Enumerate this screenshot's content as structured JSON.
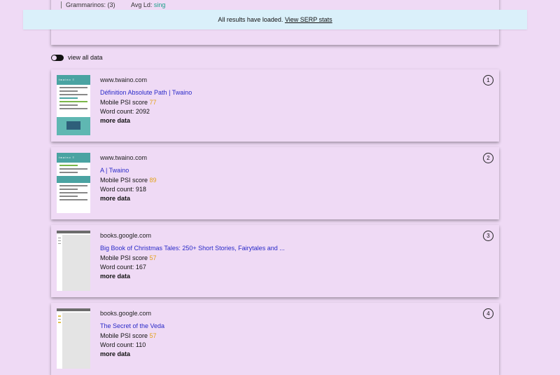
{
  "top_card": {
    "partial_left": "Grammarinos: (3)",
    "partial_right_label": "Avg Ld:",
    "partial_right_value": "sing"
  },
  "banner": {
    "text": "All results have loaded.",
    "link": "View SERP stats"
  },
  "toggle": {
    "label": "view all data"
  },
  "colors": {
    "background": "#efdaf5",
    "banner": "#daf0fa",
    "link": "#2a2ac8",
    "score": "#e3a21a"
  },
  "results": [
    {
      "rank": "1",
      "domain": "www.twaino.com",
      "title": "Définition Absolute Path | Twaino",
      "score_label": "Mobile PSI score",
      "score_value": "77",
      "word_count": "Word count: 2092",
      "more": "more data",
      "thumbnail": "twaino-page-thumbnail"
    },
    {
      "rank": "2",
      "domain": "www.twaino.com",
      "title": "A | Twaino",
      "score_label": "Mobile PSI score",
      "score_value": "89",
      "word_count": "Word count: 918",
      "more": "more data",
      "thumbnail": "twaino-page-thumbnail"
    },
    {
      "rank": "3",
      "domain": "books.google.com",
      "title": "Big Book of Christmas Tales: 250+ Short Stories, Fairytales and ...",
      "score_label": "Mobile PSI score",
      "score_value": "57",
      "word_count": "Word count: 167",
      "more": "more data",
      "thumbnail": "google-books-thumbnail"
    },
    {
      "rank": "4",
      "domain": "books.google.com",
      "title": "The Secret of the Veda",
      "score_label": "Mobile PSI score",
      "score_value": "57",
      "word_count": "Word count: 110",
      "more": "more data",
      "thumbnail": "google-books-thumbnail"
    }
  ]
}
